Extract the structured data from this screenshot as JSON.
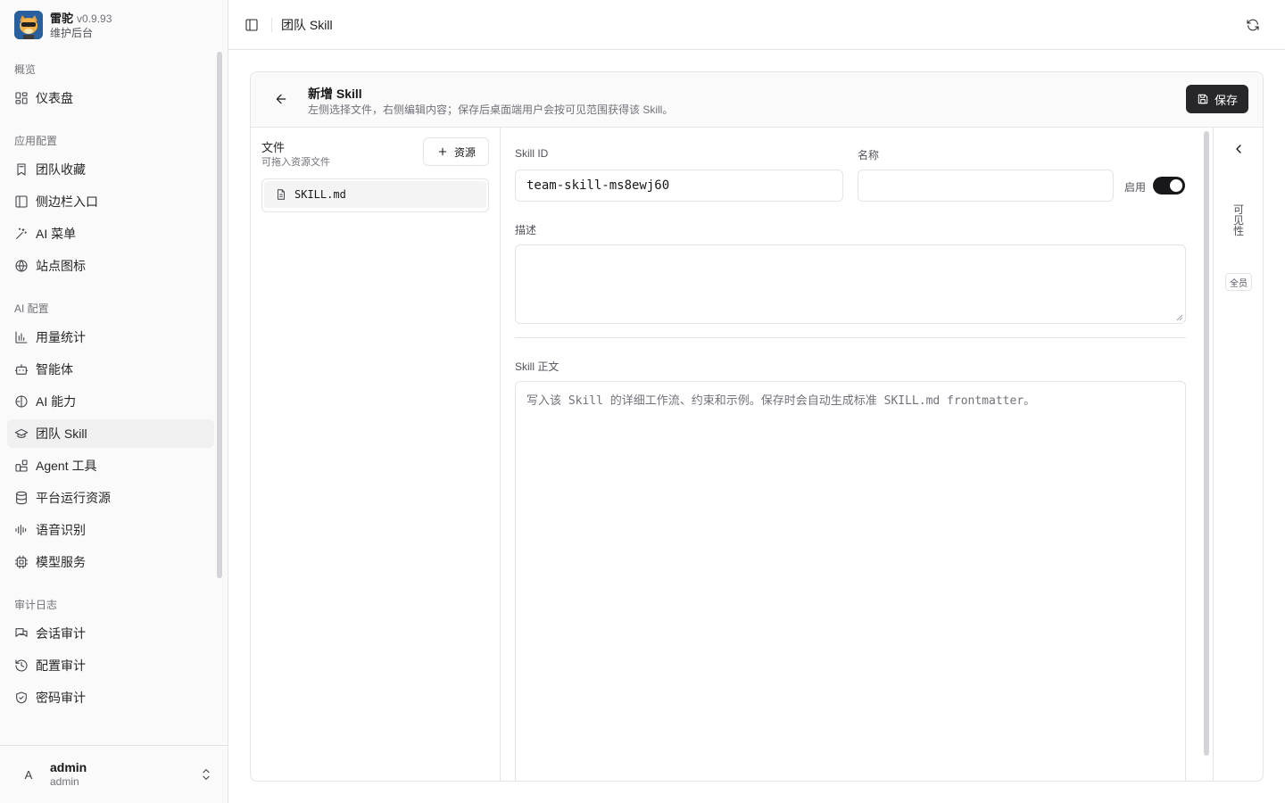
{
  "app": {
    "name": "雷驼",
    "version": "v0.9.93",
    "subtitle": "维护后台"
  },
  "sidebar": {
    "groups": [
      {
        "label": "概览",
        "items": [
          {
            "label": "仪表盘",
            "icon": "dashboard-icon"
          }
        ]
      },
      {
        "label": "应用配置",
        "items": [
          {
            "label": "团队收藏",
            "icon": "bookmark-icon"
          },
          {
            "label": "侧边栏入口",
            "icon": "panel-icon"
          },
          {
            "label": "AI 菜单",
            "icon": "wand-icon"
          },
          {
            "label": "站点图标",
            "icon": "globe-icon"
          }
        ]
      },
      {
        "label": "AI 配置",
        "items": [
          {
            "label": "用量统计",
            "icon": "bar-chart-icon"
          },
          {
            "label": "智能体",
            "icon": "bot-icon"
          },
          {
            "label": "AI 能力",
            "icon": "compass-icon"
          },
          {
            "label": "团队 Skill",
            "icon": "graduation-cap-icon",
            "active": true
          },
          {
            "label": "Agent 工具",
            "icon": "blocks-icon"
          },
          {
            "label": "平台运行资源",
            "icon": "database-icon"
          },
          {
            "label": "语音识别",
            "icon": "audio-lines-icon"
          },
          {
            "label": "模型服务",
            "icon": "cpu-icon"
          }
        ]
      },
      {
        "label": "审计日志",
        "items": [
          {
            "label": "会话审计",
            "icon": "messages-icon"
          },
          {
            "label": "配置审计",
            "icon": "history-icon"
          },
          {
            "label": "密码审计",
            "icon": "shield-icon"
          }
        ]
      }
    ]
  },
  "user": {
    "avatar_letter": "A",
    "name": "admin",
    "role": "admin"
  },
  "header": {
    "title": "团队 Skill"
  },
  "page": {
    "title": "新增 Skill",
    "subtitle": "左侧选择文件，右侧编辑内容；保存后桌面端用户会按可见范围获得该 Skill。",
    "save_label": "保存"
  },
  "files": {
    "title": "文件",
    "hint": "可拖入资源文件",
    "add_label": "资源",
    "items": [
      {
        "name": "SKILL.md"
      }
    ]
  },
  "form": {
    "skill_id_label": "Skill ID",
    "skill_id_value": "team-skill-ms8ewj60",
    "name_label": "名称",
    "name_value": "",
    "enabled_label": "启用",
    "enabled": true,
    "description_label": "描述",
    "description_value": "",
    "body_label": "Skill 正文",
    "body_placeholder": "写入该 Skill 的详细工作流、约束和示例。保存时会自动生成标准 SKILL.md frontmatter。"
  },
  "rail": {
    "title": "可见性",
    "badge": "全员"
  },
  "colors": {
    "accent": "#18181b",
    "border": "#e4e4e7",
    "sidebar_bg": "#fafafa"
  }
}
